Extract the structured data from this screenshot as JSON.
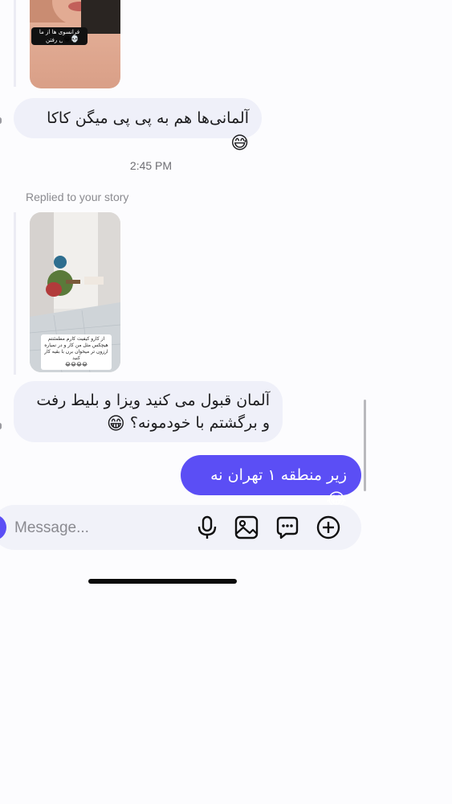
{
  "messages": [
    {
      "type": "story_reply",
      "story_caption": "فرانسوی ها از ما اسکی رفتن",
      "story_caption_emoji": "😂💀",
      "text": "آلمانی‌ها هم به پی پی میگن کاکا",
      "emoji": "😅"
    },
    {
      "type": "timestamp",
      "text": "2:45 PM"
    },
    {
      "type": "story_reply",
      "reply_label": "Replied to your story",
      "story_caption": "از کارو کیفیت کارم مطمئنتم هیچکس مثل من کار و در نمیاره ارزون تر میخوان برن با بقیه کار کنید",
      "story_caption_emoji": "😂😂😂😂",
      "text": "آلمان قبول می کنید ویزا و بلیط رفت و برگشتم با خودمونه؟",
      "emoji": "😁"
    },
    {
      "type": "outgoing",
      "text": "زیر منطقه ۱ تهران نه",
      "emoji": "😂"
    }
  ],
  "composer": {
    "placeholder": "Message...",
    "icons": [
      "microphone-icon",
      "image-icon",
      "sticker-icon",
      "plus-icon"
    ]
  },
  "colors": {
    "accent": "#5b4ef5",
    "incoming_bubble": "#eff0f9",
    "background": "#fcfcfe"
  }
}
